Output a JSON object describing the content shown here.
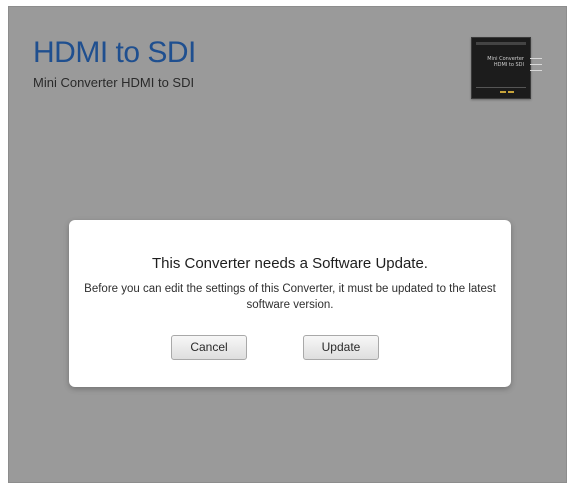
{
  "header": {
    "title": "HDMI to SDI",
    "subtitle": "Mini Converter HDMI to SDI"
  },
  "device_thumbnail": {
    "line1": "Mini Converter",
    "line2": "HDMI to SDI"
  },
  "dialog": {
    "title": "This Converter needs a Software Update.",
    "message": "Before you can edit the settings of this Converter, it must be updated to the latest software version.",
    "cancel_label": "Cancel",
    "update_label": "Update"
  },
  "colors": {
    "background": "#9a9a9a",
    "title_blue": "#1f4f8f",
    "dialog_bg": "#ffffff"
  }
}
